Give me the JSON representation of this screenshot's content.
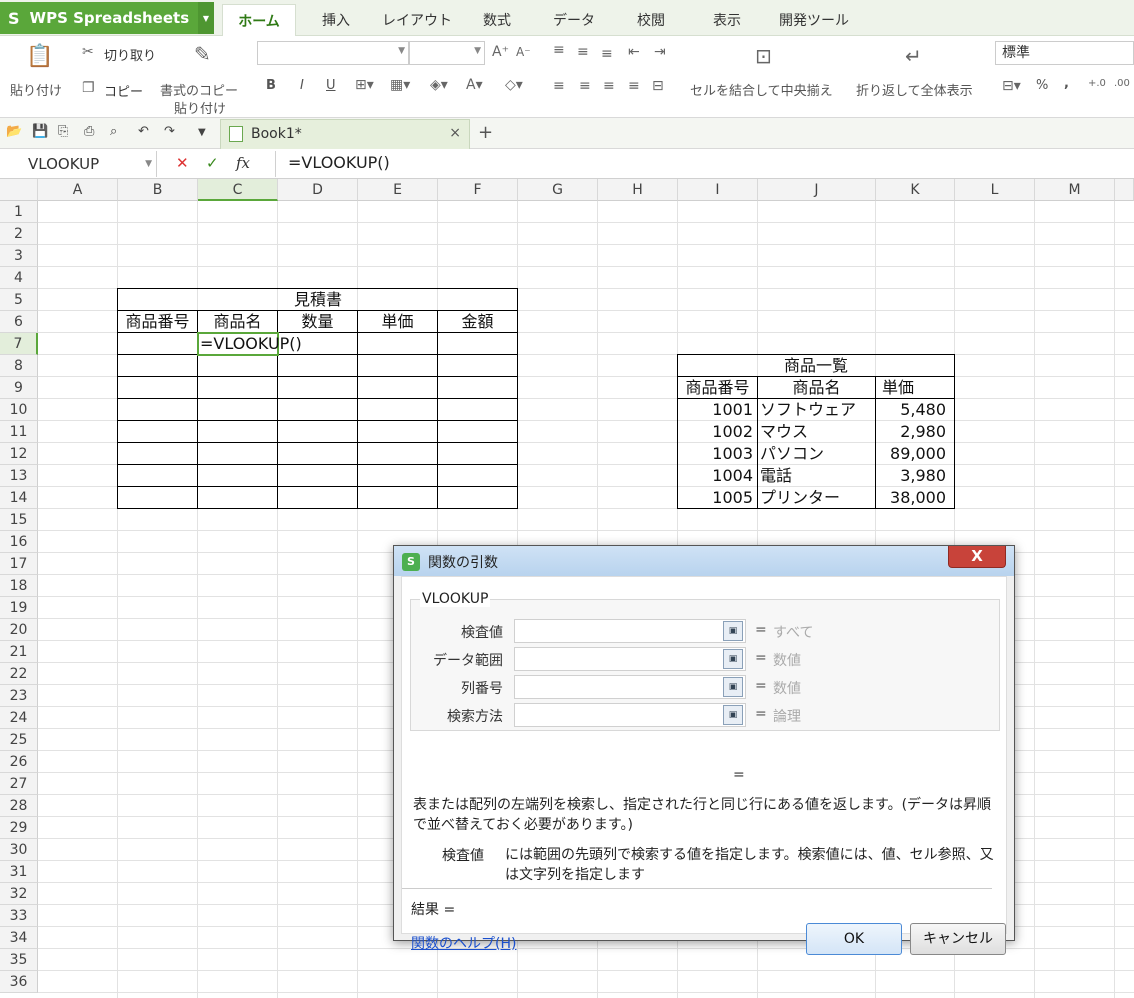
{
  "app": {
    "title": "WPS Spreadsheets",
    "logo": "S",
    "accent_color": "#5aa73a"
  },
  "ribbon_tabs": [
    "ホーム",
    "挿入",
    "レイアウト",
    "数式",
    "データ",
    "校閲",
    "表示",
    "開発ツール"
  ],
  "ribbon": {
    "paste": "貼り付け",
    "cut": "切り取り",
    "copy": "コピー",
    "format_painter_1": "書式のコピー",
    "format_painter_2": "貼り付け",
    "bold": "B",
    "italic": "I",
    "underline": "U",
    "merge_center": "セルを結合して中央揃え",
    "wrap_text": "折り返して全体表示",
    "number_format": "標準",
    "percent": "%",
    "comma": ","
  },
  "doc_tab": {
    "name": "Book1*",
    "close": "×",
    "add": "+"
  },
  "formula_bar": {
    "name_box": "VLOOKUP",
    "cancel": "✕",
    "confirm": "✓",
    "fx": "fx",
    "formula": "=VLOOKUP()"
  },
  "columns": [
    "A",
    "B",
    "C",
    "D",
    "E",
    "F",
    "G",
    "H",
    "I",
    "J",
    "K",
    "L",
    "M"
  ],
  "rows": [
    "1",
    "2",
    "3",
    "4",
    "5",
    "6",
    "7",
    "8",
    "9",
    "10",
    "11",
    "12",
    "13",
    "14",
    "15",
    "16",
    "17",
    "18",
    "19",
    "20",
    "21",
    "22",
    "23",
    "24",
    "25",
    "26",
    "27",
    "28",
    "29",
    "30",
    "31",
    "32",
    "33",
    "34",
    "35",
    "36"
  ],
  "estimate_table": {
    "title": "見積書",
    "headers": [
      "商品番号",
      "商品名",
      "数量",
      "単価",
      "金額"
    ],
    "editing_cell": "=VLOOKUP()"
  },
  "product_table": {
    "title": "商品一覧",
    "headers": [
      "商品番号",
      "商品名",
      "単価"
    ],
    "rows": [
      [
        "1001",
        "ソフトウェア",
        "5,480"
      ],
      [
        "1002",
        "マウス",
        "2,980"
      ],
      [
        "1003",
        "パソコン",
        "89,000"
      ],
      [
        "1004",
        "電話",
        "3,980"
      ],
      [
        "1005",
        "プリンター",
        "38,000"
      ]
    ]
  },
  "dialog": {
    "title": "関数の引数",
    "close": "X",
    "function_name": "VLOOKUP",
    "args": [
      {
        "label": "検査値",
        "type": "すべて"
      },
      {
        "label": "データ範囲",
        "type": "数値"
      },
      {
        "label": "列番号",
        "type": "数値"
      },
      {
        "label": "検索方法",
        "type": "論理"
      }
    ],
    "eq": "=",
    "result_eq": "=",
    "description": "表または配列の左端列を検索し、指定された行と同じ行にある値を返します。(データは昇順で並べ替えておく必要があります。)",
    "arg_desc_label": "検査値",
    "arg_desc_text": "には範囲の先頭列で検索する値を指定します。検索値には、値、セル参照、又は文字列を指定します",
    "result_label": "結果 =",
    "help_link": "関数のヘルプ(H)",
    "ok": "OK",
    "cancel": "キャンセル"
  }
}
